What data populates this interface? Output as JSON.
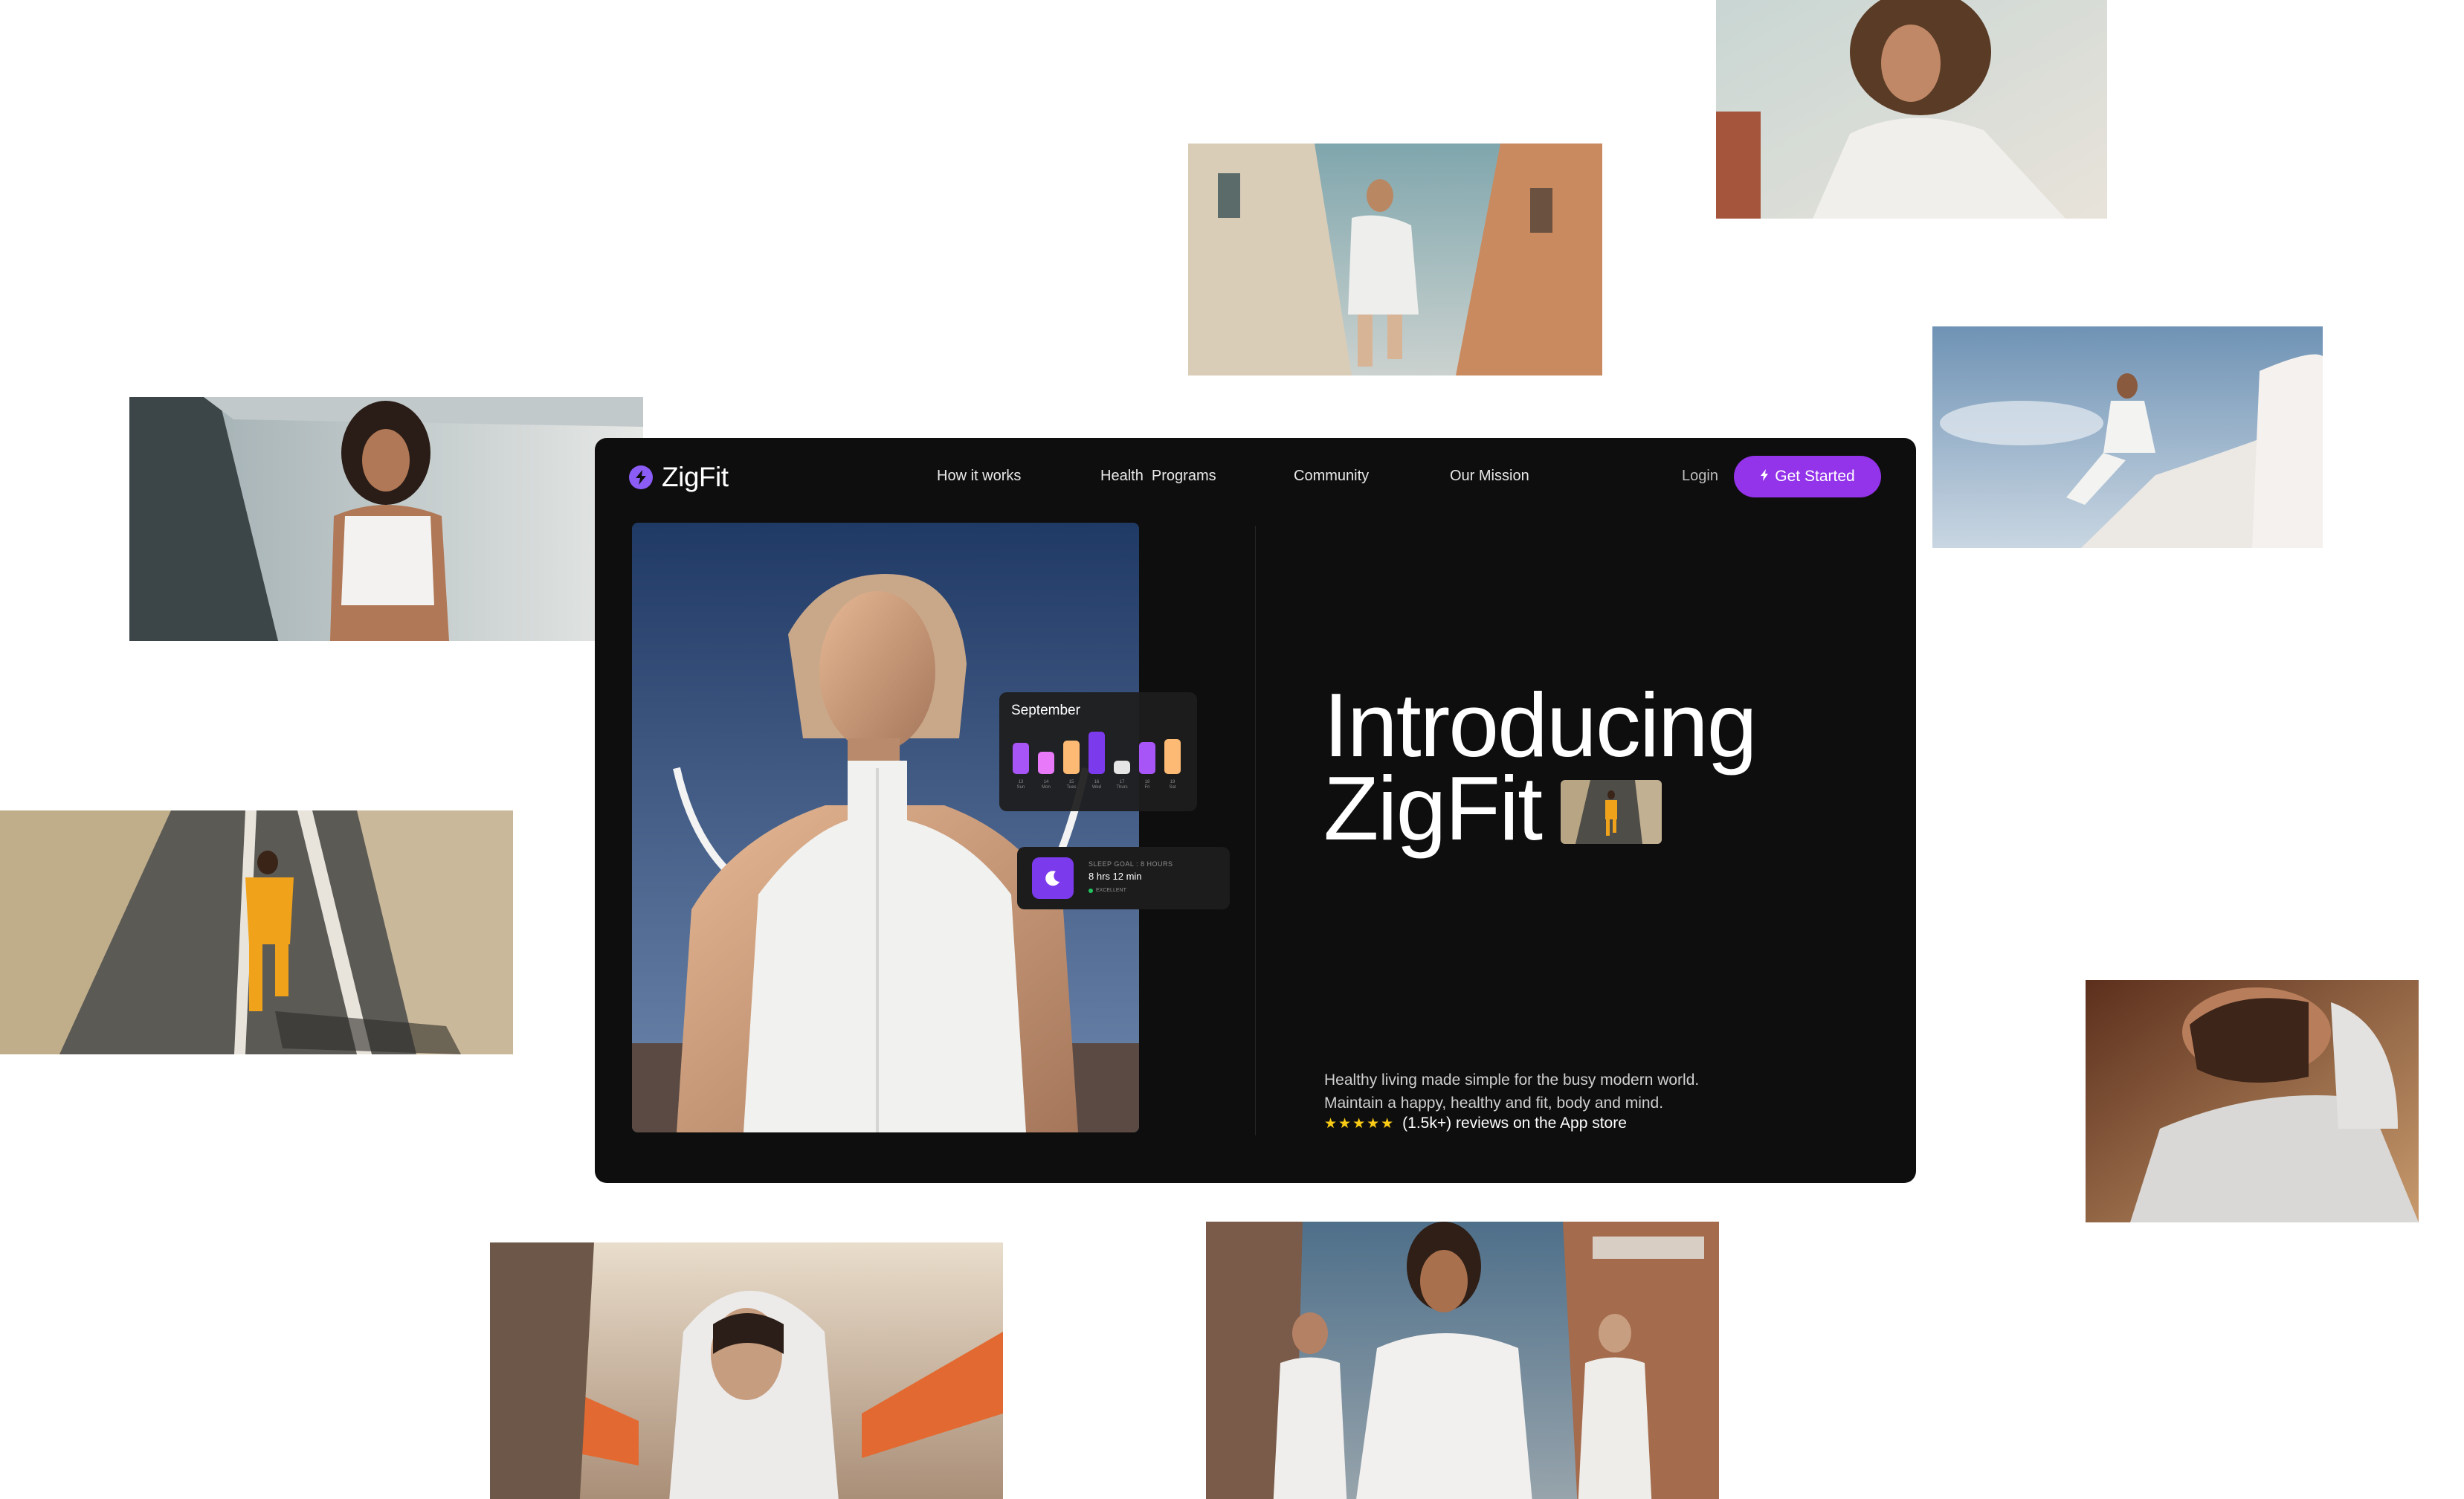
{
  "brand": {
    "name": "ZigFit",
    "logo_icon": "bolt-icon",
    "accent": "#9333ea"
  },
  "nav": {
    "links": [
      "How it works",
      "Health  Programs",
      "Community",
      "Our Mission"
    ],
    "login": "Login",
    "cta": "Get Started",
    "cta_icon": "bolt-icon"
  },
  "sleep_chart": {
    "title": "September",
    "days": [
      {
        "label": "13\nSun",
        "color": "#a855f7",
        "level": 0.7
      },
      {
        "label": "14\nMon",
        "color": "#e879f9",
        "level": 0.5
      },
      {
        "label": "15\nTues",
        "color": "#fdba74",
        "level": 0.75
      },
      {
        "label": "16\nWed",
        "color": "#7c3aed",
        "level": 0.95
      },
      {
        "label": "17\nThurs",
        "color": "#e5e5e5",
        "level": 0.3
      },
      {
        "label": "18\nFri",
        "color": "#a855f7",
        "level": 0.72
      },
      {
        "label": "19\nSat",
        "color": "#fdba74",
        "level": 0.78
      }
    ]
  },
  "sleep_goal": {
    "caption": "SLEEP GOAL : 8 HOURS",
    "value": "8 hrs 12 min",
    "status": "EXCELLENT",
    "icon": "moon-icon",
    "status_color": "#22c55e"
  },
  "hero": {
    "headline_line1": "Introducing",
    "headline_line2": "ZigFit",
    "tagline_line1": "Healthy living made simple for the busy modern world.",
    "tagline_line2": "Maintain a happy, healthy and fit, body and mind.",
    "stars": "★★★★★",
    "reviews": "(1.5k+) reviews on the App store"
  }
}
